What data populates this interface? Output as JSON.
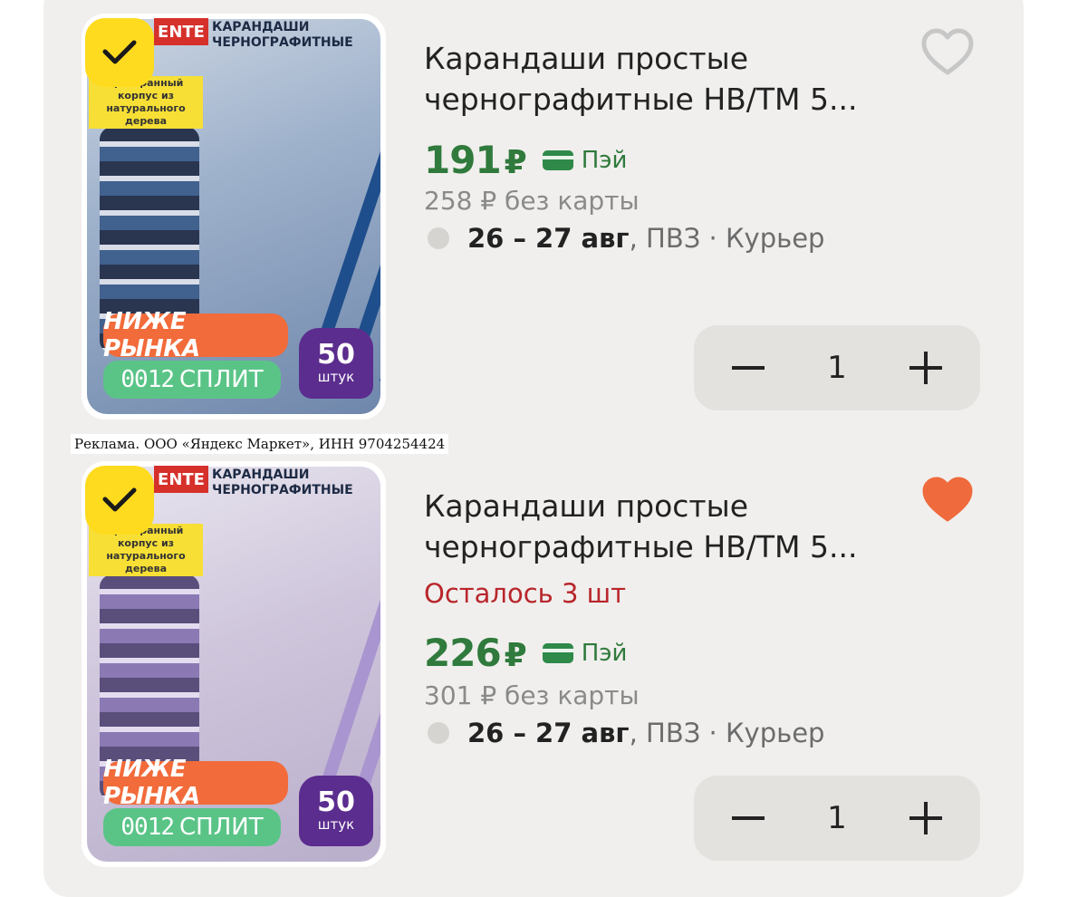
{
  "ad_notice": "Реклама. ООО «Яндекс Маркет», ИНН 9704254424",
  "products": [
    {
      "image_brand": "ENTE",
      "image_title": "КАРАНДАШИ ЧЕРНОГРАФИТНЫЕ",
      "image_sticker": "трехгранный корпус из натурального дерева",
      "badge_low": "НИЖЕ РЫНКА",
      "badge_split_digits": "0012",
      "badge_split_label": "СПЛИТ",
      "badge_count_num": "50",
      "badge_count_unit": "штук",
      "title": "Карандаши простые чернографитные НВ/ТМ 5...",
      "favorite": false,
      "stock_note": "",
      "price": "191",
      "currency": "₽",
      "pay_label": "Пэй",
      "old_price": "258 ₽  без карты",
      "delivery_date": "26 – 27 авг",
      "delivery_rest": ", ПВЗ · Курьер",
      "quantity": "1",
      "heart_color": "#c7c7c7"
    },
    {
      "image_brand": "ENTE",
      "image_title": "КАРАНДАШИ ЧЕРНОГРАФИТНЫЕ",
      "image_sticker": "трехгранный корпус из натурального дерева",
      "badge_low": "НИЖЕ РЫНКА",
      "badge_split_digits": "0012",
      "badge_split_label": "СПЛИТ",
      "badge_count_num": "50",
      "badge_count_unit": "штук",
      "title": "Карандаши простые чернографитные НВ/ТМ 5...",
      "favorite": true,
      "stock_note": "Осталось 3 шт",
      "price": "226",
      "currency": "₽",
      "pay_label": "Пэй",
      "old_price": "301 ₽  без карты",
      "delivery_date": "26 – 27 авг",
      "delivery_rest": ", ПВЗ · Курьер",
      "quantity": "1",
      "heart_color": "#ef6a3c"
    }
  ]
}
